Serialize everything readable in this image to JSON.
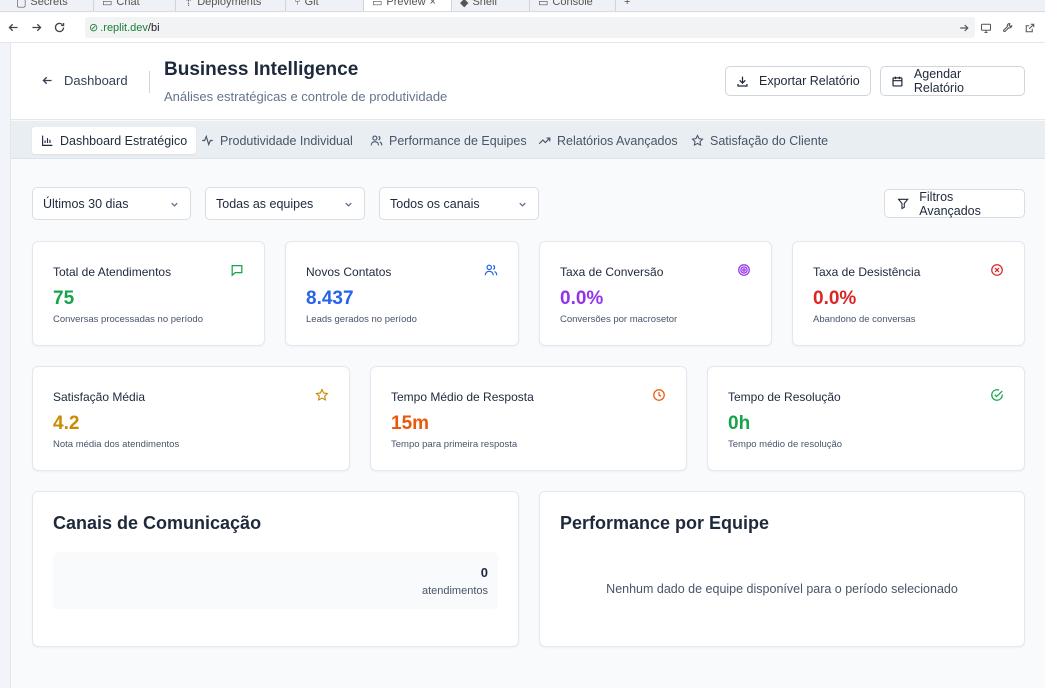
{
  "browser": {
    "tabs": [
      "Secrets",
      "Chat",
      "Deployments",
      "Git",
      "Preview",
      "Shell",
      "Console"
    ],
    "active_tab": "Preview",
    "url_host": ".replit.dev",
    "url_path": "/bi"
  },
  "header": {
    "back_label": "Dashboard",
    "title": "Business Intelligence",
    "subtitle": "Análises estratégicas e controle de produtividade",
    "export_label": "Exportar Relatório",
    "schedule_label": "Agendar Relatório"
  },
  "tabs": [
    {
      "label": "Dashboard Estratégico",
      "icon": "bar-chart-icon",
      "active": true
    },
    {
      "label": "Produtividade Individual",
      "icon": "activity-icon",
      "active": false
    },
    {
      "label": "Performance de Equipes",
      "icon": "users-icon",
      "active": false
    },
    {
      "label": "Relatórios Avançados",
      "icon": "trending-up-icon",
      "active": false
    },
    {
      "label": "Satisfação do Cliente",
      "icon": "star-icon",
      "active": false
    }
  ],
  "filters": {
    "period": "Últimos 30 dias",
    "team": "Todas as equipes",
    "channel": "Todos os canais",
    "advanced_label": "Filtros Avançados"
  },
  "metrics_row1": [
    {
      "title": "Total de Atendimentos",
      "value": "75",
      "subtitle": "Conversas processadas no período",
      "icon": "message-square-icon",
      "color": "#16a34a"
    },
    {
      "title": "Novos Contatos",
      "value": "8.437",
      "subtitle": "Leads gerados no período",
      "icon": "users-icon",
      "color": "#2563eb"
    },
    {
      "title": "Taxa de Conversão",
      "value": "0.0%",
      "subtitle": "Conversões por macrosetor",
      "icon": "target-icon",
      "color": "#9333ea"
    },
    {
      "title": "Taxa de Desistência",
      "value": "0.0%",
      "subtitle": "Abandono de conversas",
      "icon": "x-circle-icon",
      "color": "#dc2626"
    }
  ],
  "metrics_row2": [
    {
      "title": "Satisfação Média",
      "value": "4.2",
      "subtitle": "Nota média dos atendimentos",
      "icon": "star-icon",
      "color": "#ca8a04"
    },
    {
      "title": "Tempo Médio de Resposta",
      "value": "15m",
      "subtitle": "Tempo para primeira resposta",
      "icon": "clock-icon",
      "color": "#ea580c"
    },
    {
      "title": "Tempo de Resolução",
      "value": "0h",
      "subtitle": "Tempo médio de resolução",
      "icon": "check-circle-icon",
      "color": "#16a34a"
    }
  ],
  "channels": {
    "title": "Canais de Comunicação",
    "count": "0",
    "count_label": "atendimentos"
  },
  "team_performance": {
    "title": "Performance por Equipe",
    "empty": "Nenhum dado de equipe disponível para o período selecionado"
  }
}
